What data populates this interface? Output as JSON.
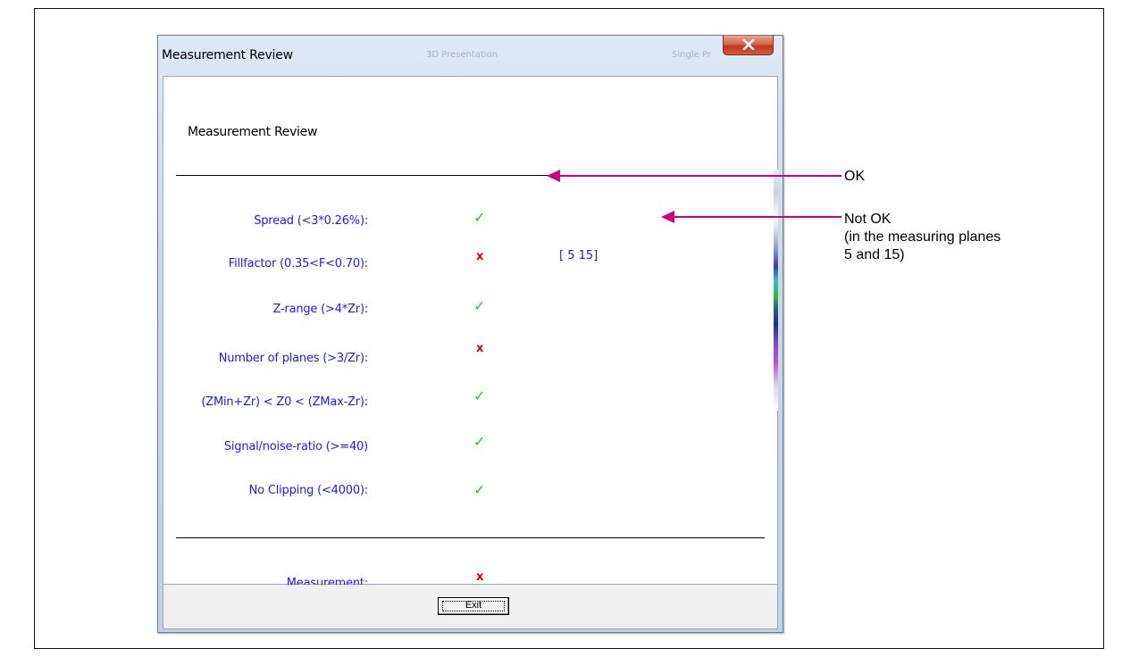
{
  "window": {
    "title": "Measurement Review",
    "background_ghost_texts": [
      "3D Presentation",
      "Single Pr"
    ]
  },
  "content": {
    "header": "Measurement Review",
    "criteria": [
      {
        "label": "Spread (<3*0.26%):",
        "status": "ok",
        "symbol": "✓",
        "detail": ""
      },
      {
        "label": "Fillfactor (0.35<F<0.70):",
        "status": "fail",
        "symbol": "x",
        "detail": "[ 5 15]"
      },
      {
        "label": "Z-range (>4*Zr):",
        "status": "ok",
        "symbol": "✓",
        "detail": ""
      },
      {
        "label": "Number of planes (>3/Zr):",
        "status": "fail",
        "symbol": "x",
        "detail": ""
      },
      {
        "label": "(ZMin+Zr) < Z0 < (ZMax-Zr):",
        "status": "ok",
        "symbol": "✓",
        "detail": ""
      },
      {
        "label": "Signal/noise-ratio (>=40)",
        "status": "ok",
        "symbol": "✓",
        "detail": ""
      },
      {
        "label": "No Clipping (<4000):",
        "status": "ok",
        "symbol": "✓",
        "detail": ""
      }
    ],
    "summary": {
      "label": "Measurement:",
      "status": "fail",
      "symbol": "x"
    }
  },
  "footer": {
    "exit_label": "Exit"
  },
  "annotations": {
    "ok_callout": "OK",
    "not_ok_callout": [
      "Not OK",
      "(in the measuring planes",
      "5 and 15)"
    ]
  },
  "colors": {
    "label_blue": "#1a1aff",
    "ok_green": "#22cc22",
    "fail_red": "#e00000",
    "callout_magenta": "#d4007a"
  },
  "icons": {
    "ok": "check-icon",
    "fail": "cross-icon",
    "close": "close-icon"
  }
}
